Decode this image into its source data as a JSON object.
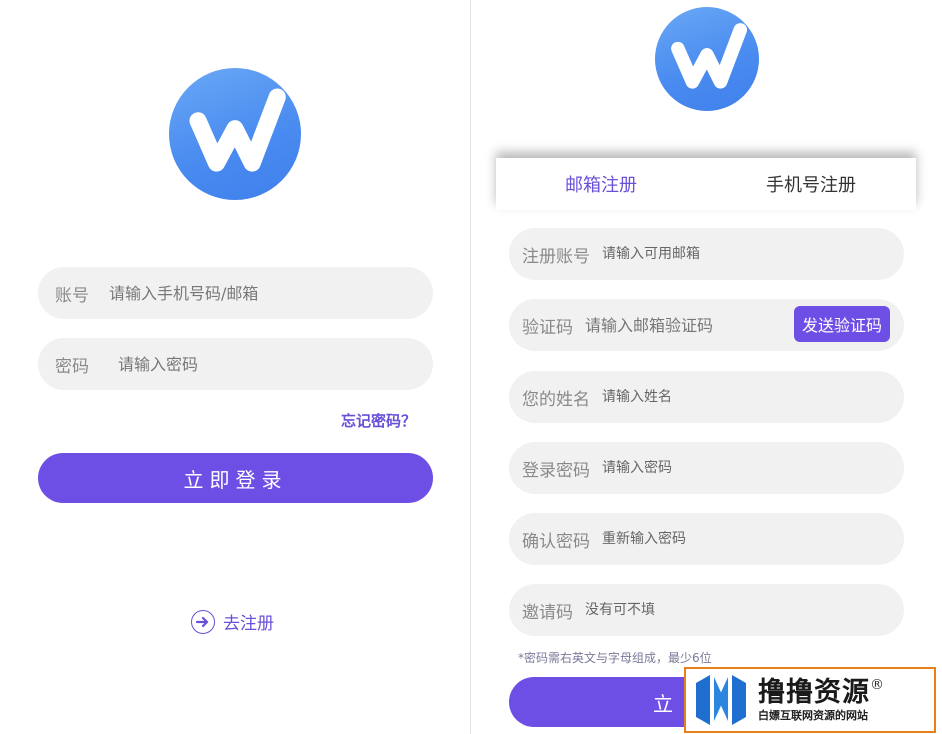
{
  "login": {
    "account_label": "账号",
    "account_placeholder": "请输入手机号码/邮箱",
    "password_label": "密码",
    "password_placeholder": "请输入密码",
    "forgot_link": "忘记密码？",
    "submit_label": "立即登录",
    "register_link": "去注册"
  },
  "register": {
    "tabs": [
      {
        "label": "邮箱注册",
        "active": true
      },
      {
        "label": "手机号注册",
        "active": false
      }
    ],
    "fields": [
      {
        "label": "注册账号",
        "placeholder": "请输入可用邮箱"
      },
      {
        "label": "验证码",
        "placeholder": "请输入邮箱验证码",
        "button": "发送验证码"
      },
      {
        "label": "您的姓名",
        "placeholder": "请输入姓名"
      },
      {
        "label": "登录密码",
        "placeholder": "请输入密码"
      },
      {
        "label": "确认密码",
        "placeholder": "重新输入密码"
      },
      {
        "label": "邀请码",
        "placeholder": "没有可不填"
      }
    ],
    "hint": "*密码需右英文与字母组成，最少6位",
    "submit_label_visible": "立"
  },
  "watermark": {
    "title": "撸撸资源",
    "registered": "®",
    "subtitle": "白嫖互联网资源的网站"
  },
  "icons": {
    "app_logo": "w-logo-icon",
    "register_arrow": "arrow-right-circle-icon"
  },
  "colors": {
    "accent": "#6e4fe6",
    "logo_blue": "#4a8cf0",
    "field_bg": "#f1f1f1",
    "watermark_border": "#e87f1a"
  }
}
